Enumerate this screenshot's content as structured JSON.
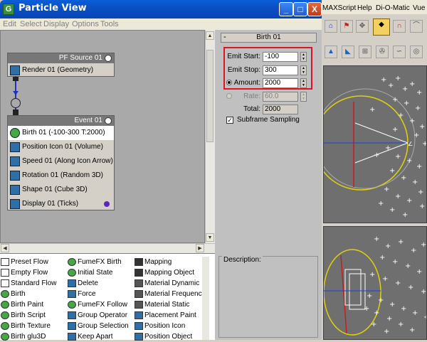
{
  "window": {
    "title": "Particle View",
    "buttons": {
      "minimize": "_",
      "maximize": "□",
      "close": "X"
    }
  },
  "menu": [
    "Edit",
    "Select",
    "Display",
    "Options",
    "Tools"
  ],
  "canvas": {
    "source_node": {
      "title": "PF Source 01",
      "items": [
        "Render 01 (Geometry)"
      ]
    },
    "event_node": {
      "title": "Event 01",
      "items": [
        "Birth 01 (-100-300 T:2000)",
        "Position Icon 01 (Volume)",
        "Speed 01 (Along Icon Arrow)",
        "Rotation 01 (Random 3D)",
        "Shape 01 (Cube 3D)",
        "Display 01 (Ticks)"
      ]
    }
  },
  "birth_panel": {
    "header": "Birth 01",
    "collapse": "-",
    "emit_start_label": "Emit Start:",
    "emit_start_value": "-100",
    "emit_stop_label": "Emit Stop:",
    "emit_stop_value": "300",
    "amount_label": "Amount:",
    "amount_value": "2000",
    "rate_label": "Rate:",
    "rate_value": "60.0",
    "total_label": "Total:",
    "total_value": "2000",
    "subframe_label": "Subframe Sampling"
  },
  "description_label": "Description:",
  "operator_list": {
    "col1": [
      "Preset Flow",
      "Empty Flow",
      "Standard Flow",
      "Birth",
      "Birth Paint",
      "Birth Script",
      "Birth Texture",
      "Birth glu3D"
    ],
    "col2": [
      "FumeFX Birth",
      "Initial State",
      "Delete",
      "Force",
      "FumeFX Follow",
      "Group Operator",
      "Group Selection",
      "Keep Apart"
    ],
    "col3": [
      "Mapping",
      "Mapping Object",
      "Material Dynamic",
      "Material Frequency",
      "Material Static",
      "Placement Paint",
      "Position Icon",
      "Position Object"
    ]
  },
  "max_menu": [
    "MAXScript",
    "Help",
    "Di-O-Matic",
    "Vue"
  ]
}
